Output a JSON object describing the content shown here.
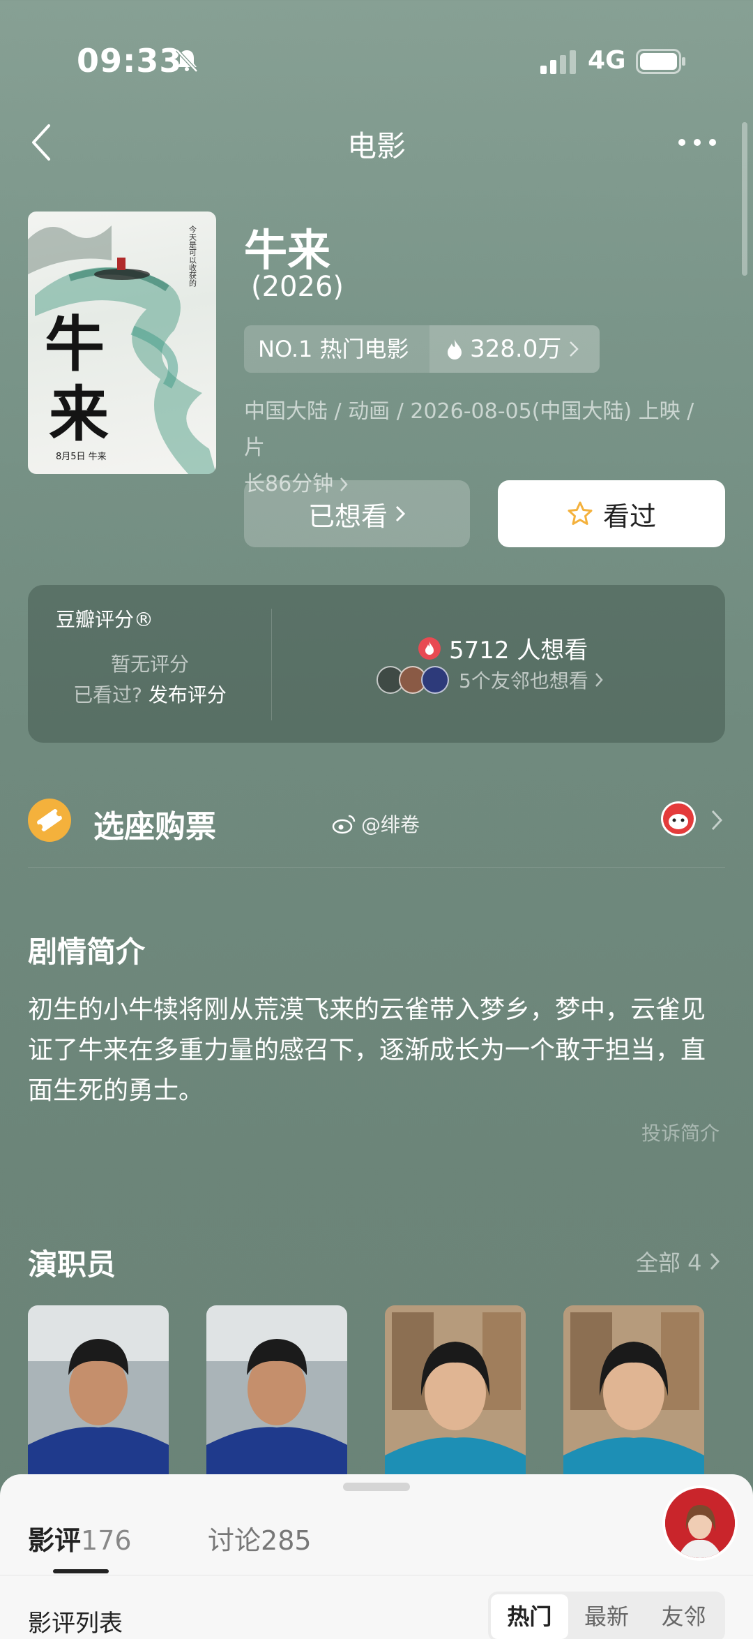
{
  "status_bar": {
    "time": "09:33",
    "network": "4G"
  },
  "nav": {
    "title": "电影"
  },
  "movie": {
    "title": "牛来",
    "year": "(2026)",
    "rank_label": "NO.1 热门电影",
    "heat": "328.0万",
    "meta_line1": "中国大陆 / 动画 / 2026-08-05(中国大陆) 上映 / 片",
    "meta_line2": "长86分钟",
    "wish_button": "已想看",
    "seen_button": "看过"
  },
  "rating": {
    "label": "豆瓣评分®",
    "no_rating": "暂无评分",
    "seen_prompt": "已看过?",
    "publish": "发布评分",
    "want_count": "5712 人想看",
    "friends_text": "5个友邻也想看"
  },
  "ticket": {
    "label": "选座购票",
    "weibo_handle": "@绯卷"
  },
  "synopsis": {
    "title": "剧情简介",
    "text": "初生的小牛犊将刚从荒漠飞来的云雀带入梦乡，梦中，云雀见证了牛来在多重力量的感召下，逐渐成长为一个敢于担当，直面生死的勇士。",
    "report": "投诉简介"
  },
  "cast": {
    "title": "演职员",
    "all_label": "全部 4"
  },
  "sheet": {
    "tab_reviews": "影评",
    "tab_reviews_count": "176",
    "tab_discussion": "讨论",
    "tab_discussion_count": "285",
    "list_label": "影评列表",
    "sort_options": [
      "热门",
      "最新",
      "友邻"
    ],
    "sort_selected": "热门"
  },
  "colors": {
    "background": "#7a9589",
    "card": "#55705f",
    "ticket_icon": "#f4b13c",
    "star": "#f4b13c",
    "flame": "#e84a52"
  }
}
